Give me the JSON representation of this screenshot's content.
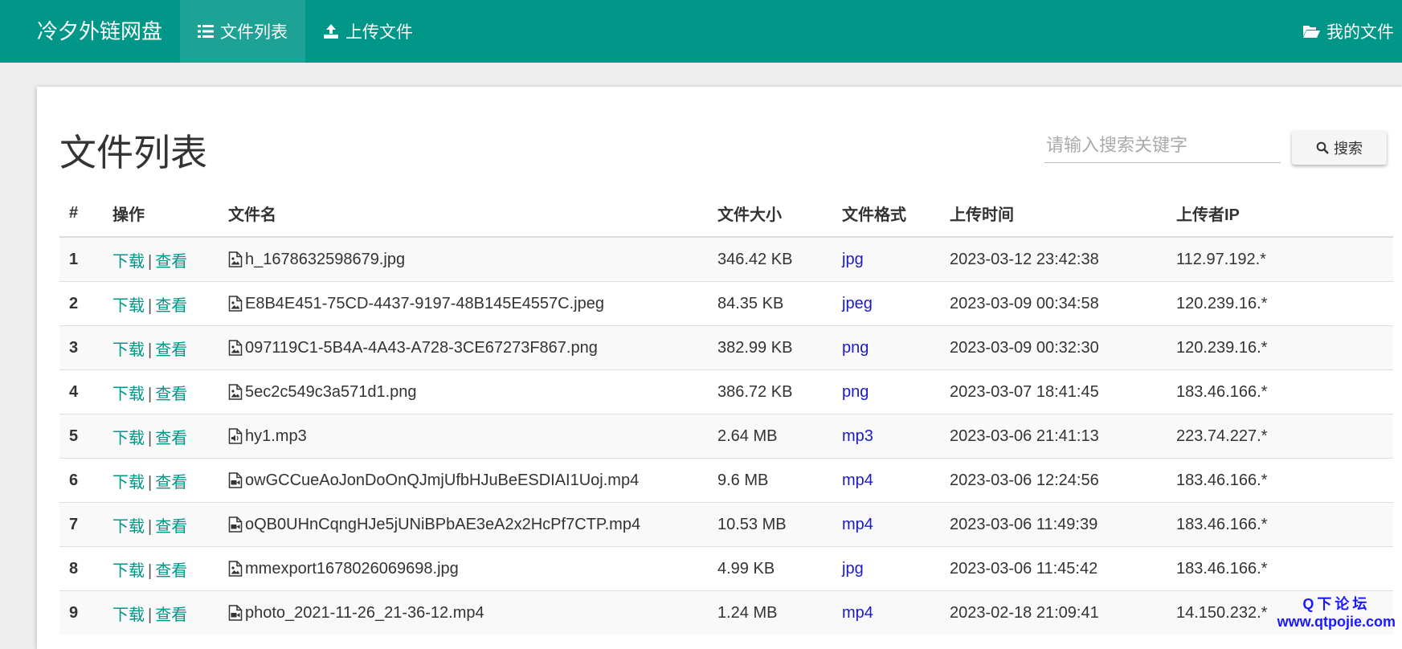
{
  "navbar": {
    "brand": "冷夕外链网盘",
    "items": [
      {
        "label": "文件列表",
        "icon": "list-icon",
        "active": true
      },
      {
        "label": "上传文件",
        "icon": "upload-icon",
        "active": false
      }
    ],
    "right": {
      "label": "我的文件",
      "icon": "folder-open-icon"
    },
    "color": "#009688"
  },
  "main": {
    "title": "文件列表",
    "search": {
      "placeholder": "请输入搜索关键字",
      "button_label": "搜索",
      "button_icon": "search-icon"
    },
    "table": {
      "headers": [
        "#",
        "操作",
        "文件名",
        "文件大小",
        "文件格式",
        "上传时间",
        "上传者IP"
      ],
      "action_download": "下载",
      "action_view": "查看",
      "action_separator": "|",
      "rows": [
        {
          "num": "1",
          "icon": "image-file-icon",
          "name": "h_1678632598679.jpg",
          "size": "346.42 KB",
          "format": "jpg",
          "time": "2023-03-12 23:42:38",
          "ip": "112.97.192.*"
        },
        {
          "num": "2",
          "icon": "image-file-icon",
          "name": "E8B4E451-75CD-4437-9197-48B145E4557C.jpeg",
          "size": "84.35 KB",
          "format": "jpeg",
          "time": "2023-03-09 00:34:58",
          "ip": "120.239.16.*"
        },
        {
          "num": "3",
          "icon": "image-file-icon",
          "name": "097119C1-5B4A-4A43-A728-3CE67273F867.png",
          "size": "382.99 KB",
          "format": "png",
          "time": "2023-03-09 00:32:30",
          "ip": "120.239.16.*"
        },
        {
          "num": "4",
          "icon": "image-file-icon",
          "name": "5ec2c549c3a571d1.png",
          "size": "386.72 KB",
          "format": "png",
          "time": "2023-03-07 18:41:45",
          "ip": "183.46.166.*"
        },
        {
          "num": "5",
          "icon": "audio-file-icon",
          "name": "hy1.mp3",
          "size": "2.64 MB",
          "format": "mp3",
          "time": "2023-03-06 21:41:13",
          "ip": "223.74.227.*"
        },
        {
          "num": "6",
          "icon": "video-file-icon",
          "name": "owGCCueAoJonDoOnQJmjUfbHJuBeESDIAI1Uoj.mp4",
          "size": "9.6 MB",
          "format": "mp4",
          "time": "2023-03-06 12:24:56",
          "ip": "183.46.166.*"
        },
        {
          "num": "7",
          "icon": "video-file-icon",
          "name": "oQB0UHnCqngHJe5jUNiBPbAE3eA2x2HcPf7CTP.mp4",
          "size": "10.53 MB",
          "format": "mp4",
          "time": "2023-03-06 11:49:39",
          "ip": "183.46.166.*"
        },
        {
          "num": "8",
          "icon": "image-file-icon",
          "name": "mmexport1678026069698.jpg",
          "size": "4.99 KB",
          "format": "jpg",
          "time": "2023-03-06 11:45:42",
          "ip": "183.46.166.*"
        },
        {
          "num": "9",
          "icon": "video-file-icon",
          "name": "photo_2021-11-26_21-36-12.mp4",
          "size": "1.24 MB",
          "format": "mp4",
          "time": "2023-02-18 21:09:41",
          "ip": "14.150.232.*"
        }
      ]
    }
  },
  "watermark": {
    "line1": "Q下论坛",
    "line2": "www.qtpojie.com"
  }
}
